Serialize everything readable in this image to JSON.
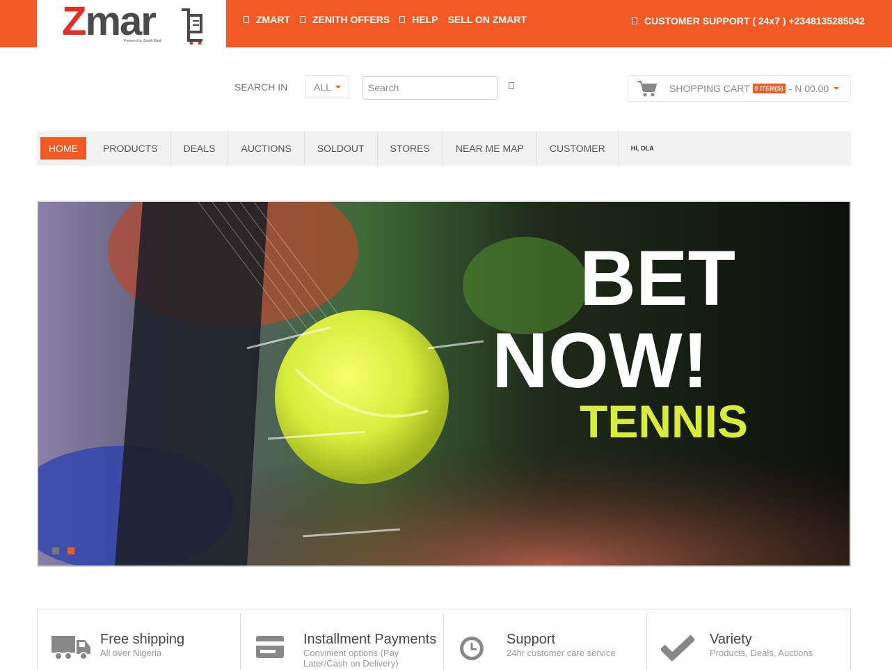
{
  "brand": {
    "logo_z": "Z",
    "logo_rest": "mar",
    "powered_by": "Powered by Zenith Bank"
  },
  "top_links": [
    "ZMART",
    "ZENITH OFFERS",
    "HELP"
  ],
  "sell_link": "SELL ON ZMART",
  "support": "CUSTOMER SUPPORT ( 24x7 ) +2348135285042",
  "search": {
    "label": "SEARCH IN",
    "scope": "ALL",
    "placeholder": "Search"
  },
  "cart": {
    "label": "SHOPPING CART",
    "items_badge": "0 ITEM(S)",
    "total": "- N 00.00"
  },
  "nav": {
    "items": [
      "HOME",
      "PRODUCTS",
      "DEALS",
      "AUCTIONS",
      "SOLDOUT",
      "STORES",
      "NEAR ME MAP",
      "CUSTOMER"
    ],
    "greeting": "HI, OLA"
  },
  "hero": {
    "line1": "BET",
    "line2": "NOW!",
    "line3": "TENNIS"
  },
  "features": [
    {
      "title": "Free shipping",
      "subtitle": "All over Nigeria",
      "icon": "truck-icon"
    },
    {
      "title": "Installment Payments",
      "subtitle": "Convinient options (Pay Later/Cash on Delivery)",
      "icon": "credit-card-icon"
    },
    {
      "title": "Support",
      "subtitle": "24hr customer care service",
      "icon": "clock-icon"
    },
    {
      "title": "Variety",
      "subtitle": "Products, Deals, Auctions",
      "icon": "checkmark-icon"
    }
  ],
  "colors": {
    "accent": "#f15a24",
    "logo_red": "#e0302a",
    "tennis_green": "#d7ec3c"
  }
}
